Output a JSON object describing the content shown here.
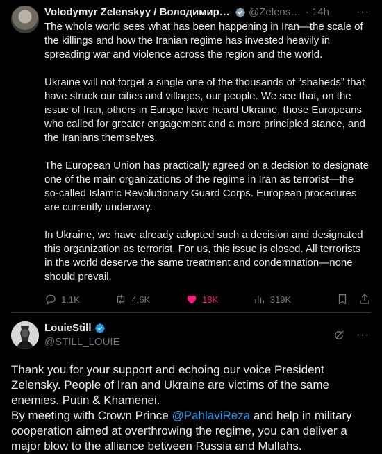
{
  "tweet": {
    "author_name": "Volodymyr Zelenskyy / Володимир Зеле…",
    "handle": "@Zelensky…",
    "separator": "·",
    "time": "14h",
    "paragraphs": [
      "The whole world sees what has been happening in Iran—the scale of the killings and how the Iranian regime has invested heavily in spreading war and violence across the region and the world.",
      "Ukraine will not forget a single one of the thousands of “shaheds” that have struck our cities and villages, our people. We see that, on the issue of Iran, others in Europe have heard Ukraine, those Europeans who called for greater engagement and a more principled stance, and the Iranians themselves.",
      "The European Union has practically agreed on a decision to designate one of the main organizations of the regime in Iran as terrorist—the so-called Islamic Revolutionary Guard Corps. European procedures are currently underway.",
      "In Ukraine, we have already adopted such a decision and designated this organization as terrorist. For us, this issue is closed. All terrorists in the world deserve the same treatment and condemnation—none should prevail."
    ],
    "stats": {
      "replies": "1.1K",
      "reposts": "4.6K",
      "likes": "18K",
      "views": "319K"
    },
    "colors": {
      "like": "#f91880",
      "verified": "#1d9bf0",
      "muted": "#71767b"
    }
  },
  "reply": {
    "author_name": "LouieStill",
    "handle": "@STILL_LOUIE",
    "text_part1": "Thank you for your support and echoing our voice President Zelensky. People of Iran and Ukraine are victims of the same enemies. Putin & Khamenei.",
    "text_part2": "By meeting with Crown Prince ",
    "mention": "@PahlaviReza",
    "text_part3": " and help in military cooperation aimed at overthrowing the regime, you can deliver a major blow to the alliance between Russia and Mullahs."
  },
  "icons": [
    "verified-badge-icon",
    "more-icon",
    "reply-icon",
    "repost-icon",
    "like-icon",
    "views-icon",
    "bookmark-icon",
    "share-icon",
    "grok-icon"
  ]
}
